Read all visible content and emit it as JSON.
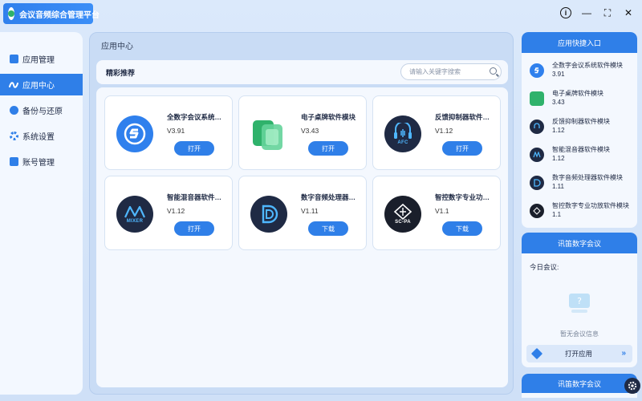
{
  "app": {
    "title": "会议音频综合管理平台"
  },
  "window": {
    "info": "i",
    "minimize": "—",
    "fullscreen": "⛶",
    "close": "✕"
  },
  "sidebar": {
    "items": [
      {
        "label": "应用管理",
        "active": false
      },
      {
        "label": "应用中心",
        "active": true
      },
      {
        "label": "备份与还原",
        "active": false
      },
      {
        "label": "系统设置",
        "active": false
      },
      {
        "label": "账号管理",
        "active": false
      }
    ]
  },
  "main": {
    "title": "应用中心",
    "featured_label": "精彩推荐",
    "search_placeholder": "请输入关键字搜索",
    "cards": [
      {
        "name": "全数字会议系统软件模块",
        "version": "V3.91",
        "button": "打开",
        "icon": "digital-conference-icon"
      },
      {
        "name": "电子桌牌软件模块",
        "version": "V3.43",
        "button": "打开",
        "icon": "e-nameplate-icon"
      },
      {
        "name": "反馈抑制器软件模块",
        "version": "V1.12",
        "button": "打开",
        "icon": "afc-icon"
      },
      {
        "name": "智能混音器软件模块",
        "version": "V1.12",
        "button": "打开",
        "icon": "mixer-icon"
      },
      {
        "name": "数字音频处理器软件模块",
        "version": "V1.11",
        "button": "下载",
        "icon": "dsp-icon"
      },
      {
        "name": "智控数字专业功放软件模块",
        "version": "V1.1",
        "button": "下载",
        "icon": "sc-pa-icon"
      }
    ],
    "badges": {
      "afc": "AFC",
      "mixer": "MIXER",
      "scpa": "SC-PA"
    }
  },
  "quick_access": {
    "title": "应用快捷入口",
    "items": [
      {
        "name": "全数字会议系统软件模块",
        "version": "3.91"
      },
      {
        "name": "电子桌牌软件模块",
        "version": "3.43"
      },
      {
        "name": "反馈抑制器软件模块",
        "version": "1.12"
      },
      {
        "name": "智能混音器软件模块",
        "version": "1.12"
      },
      {
        "name": "数字音频处理器软件模块",
        "version": "1.11"
      },
      {
        "name": "智控数字专业功放软件模块",
        "version": "1.1"
      }
    ]
  },
  "meeting": {
    "title": "讯笛数字会议",
    "today_label": "今日会议:",
    "empty_text": "暂无会议信息",
    "open_app": "打开应用",
    "chevron": "»"
  },
  "meeting2": {
    "title": "讯笛数字会议"
  },
  "colors": {
    "accent": "#2f7fe8",
    "dark_icon": "#1f2a44",
    "green": "#2fb26b"
  }
}
